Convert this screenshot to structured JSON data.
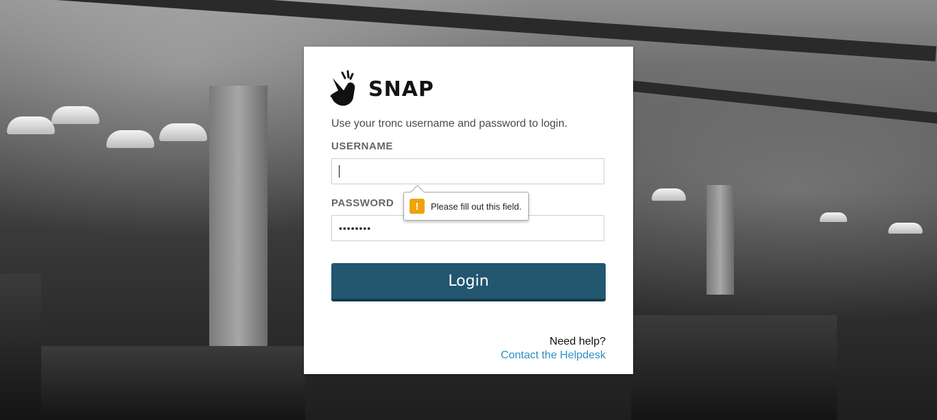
{
  "brand": {
    "name": "SNAP",
    "icon": "snap-fingers-icon"
  },
  "intro_text": "Use your tronc username and password to login.",
  "form": {
    "username_label": "USERNAME",
    "username_value": "",
    "password_label": "PASSWORD",
    "password_value": "••••••••",
    "login_label": "Login"
  },
  "validation": {
    "message": "Please fill out this field.",
    "icon": "warning-icon",
    "icon_glyph": "!",
    "icon_color": "#f0a30a"
  },
  "help": {
    "question": "Need help?",
    "link_text": "Contact the Helpdesk"
  },
  "colors": {
    "button": "#23566f",
    "link": "#2b8fc1"
  }
}
